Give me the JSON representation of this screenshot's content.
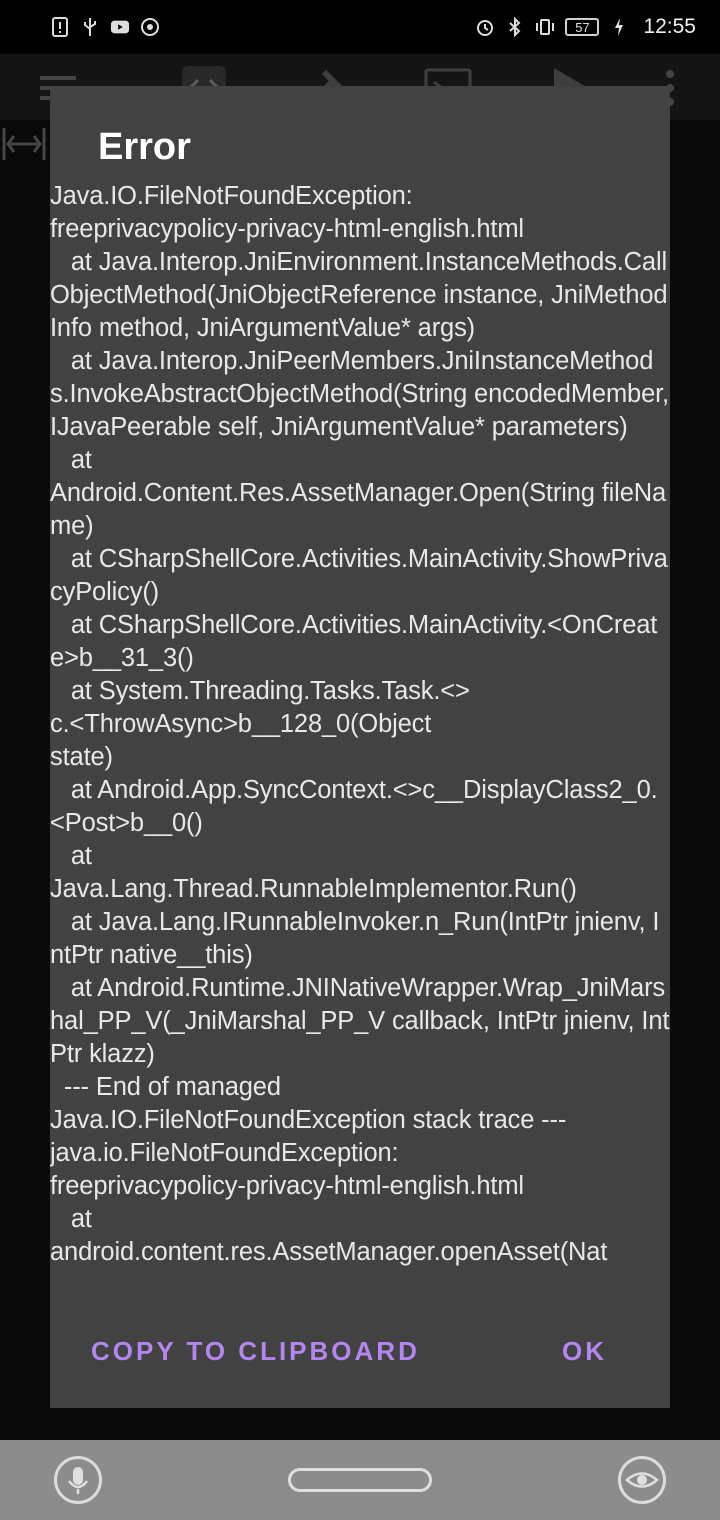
{
  "status_bar": {
    "time": "12:55",
    "battery": "57",
    "left_icons": [
      "alert-icon",
      "usb-icon",
      "youtube-icon",
      "chrome-icon"
    ],
    "right_icons": [
      "alarm-icon",
      "bluetooth-icon",
      "vibrate-icon",
      "battery-icon",
      "charging-icon"
    ]
  },
  "toolbar": {
    "icons": [
      "menu-icon",
      "code-icon",
      "tools-icon",
      "terminal-icon",
      "run-icon",
      "more-icon"
    ]
  },
  "dialog": {
    "title": "Error",
    "message": "Java.IO.FileNotFoundException:\nfreeprivacypolicy-privacy-html-english.html\n   at Java.Interop.JniEnvironment.InstanceMethods.CallObjectMethod(JniObjectReference instance, JniMethodInfo method, JniArgumentValue* args)\n   at Java.Interop.JniPeerMembers.JniInstanceMethods.InvokeAbstractObjectMethod(String encodedMember, IJavaPeerable self, JniArgumentValue* parameters)\n   at\nAndroid.Content.Res.AssetManager.Open(String fileName)\n   at CSharpShellCore.Activities.MainActivity.ShowPrivacyPolicy()\n   at CSharpShellCore.Activities.MainActivity.<OnCreate>b__31_3()\n   at System.Threading.Tasks.Task.<>\nc.<ThrowAsync>b__128_0(Object\nstate)\n   at Android.App.SyncContext.<>c__DisplayClass2_0.<Post>b__0()\n   at\nJava.Lang.Thread.RunnableImplementor.Run()\n   at Java.Lang.IRunnableInvoker.n_Run(IntPtr jnienv, IntPtr native__this)\n   at Android.Runtime.JNINativeWrapper.Wrap_JniMarshal_PP_V(_JniMarshal_PP_V callback, IntPtr jnienv, IntPtr klazz)\n  --- End of managed\nJava.IO.FileNotFoundException stack trace ---\njava.io.FileNotFoundException:\nfreeprivacypolicy-privacy-html-english.html\n   at\nandroid.content.res.AssetManager.openAsset(Nat",
    "copy_label": "COPY TO CLIPBOARD",
    "ok_label": "OK",
    "accent_color": "#b386f0"
  },
  "nav_bar": {
    "icons": [
      "microphone-icon",
      "home-pill",
      "eye-icon"
    ]
  }
}
